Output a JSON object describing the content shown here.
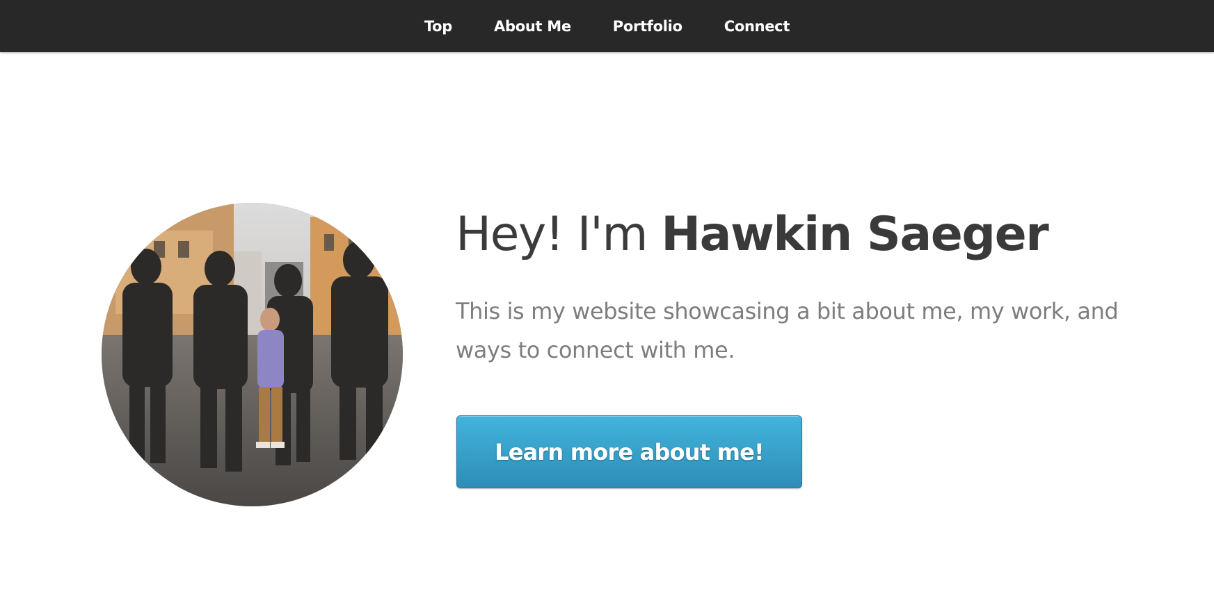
{
  "nav": {
    "items": [
      {
        "label": "Top"
      },
      {
        "label": "About Me"
      },
      {
        "label": "Portfolio"
      },
      {
        "label": "Connect"
      }
    ]
  },
  "hero": {
    "greeting_prefix": "Hey! I'm ",
    "name": "Hawkin Saeger",
    "tagline": "This is my website showcasing a bit about me, my work, and ways to connect with me.",
    "cta_label": "Learn more about me!"
  },
  "colors": {
    "nav_background": "#282828",
    "nav_text": "#ffffff",
    "heading_text": "#3a3a3a",
    "tagline_text": "#7d7d7d",
    "button_blue": "#3aa8d2"
  },
  "icons": {
    "avatar": "profile-photo"
  }
}
